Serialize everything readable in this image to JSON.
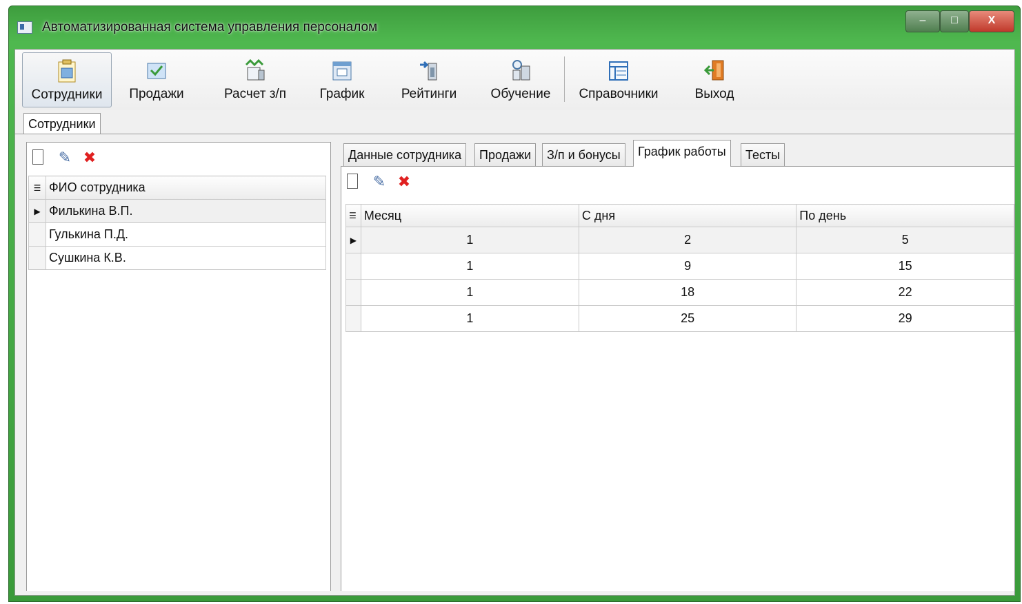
{
  "window": {
    "title": "Автоматизированная система управления персоналом",
    "controls": {
      "minimize": "–",
      "maximize": "□",
      "close": "X"
    }
  },
  "toolbar": {
    "items": [
      {
        "label": "Сотрудники",
        "icon": "clipboard-icon",
        "active": true
      },
      {
        "label": "Продажи",
        "icon": "sales-icon"
      },
      {
        "label": "Расчет з/п",
        "icon": "payroll-icon"
      },
      {
        "label": "График",
        "icon": "schedule-icon"
      },
      {
        "label": "Рейтинги",
        "icon": "ratings-icon"
      },
      {
        "label": "Обучение",
        "icon": "training-icon"
      },
      {
        "label": "Справочники",
        "icon": "reference-icon"
      },
      {
        "label": "Выход",
        "icon": "exit-door-icon"
      }
    ]
  },
  "document_tab": "Сотрудники",
  "employees": {
    "header": "ФИО сотрудника",
    "rows": [
      "Филькина В.П.",
      "Гулькина П.Д.",
      "Сушкина К.В."
    ],
    "selected": 0
  },
  "tabs": {
    "items": [
      "Данные сотрудника",
      "Продажи",
      "З/п и бонусы",
      "График работы",
      "Тесты"
    ],
    "active": "График работы"
  },
  "schedule": {
    "headers": [
      "Месяц",
      "С дня",
      "По день"
    ],
    "rows": [
      [
        "1",
        "2",
        "5"
      ],
      [
        "1",
        "9",
        "15"
      ],
      [
        "1",
        "18",
        "22"
      ],
      [
        "1",
        "25",
        "29"
      ]
    ]
  },
  "colors": {
    "frame": "#3e9d3e",
    "delete": "#e02020",
    "close_button": "#c0392b"
  }
}
